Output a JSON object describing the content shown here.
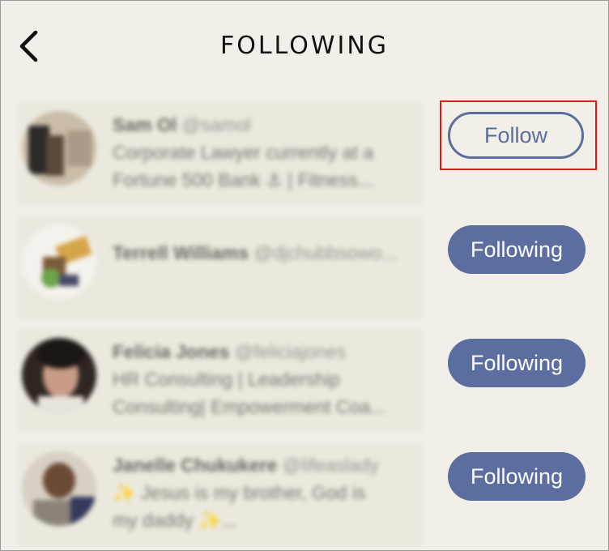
{
  "header": {
    "title": "FOLLOWING"
  },
  "users": [
    {
      "name": "Sam Ol",
      "handle": "@samol",
      "bio_lines": [
        "Corporate Lawyer currently at a",
        "Fortune 500 Bank ⚓ | Fitness..."
      ],
      "button_label": "Follow",
      "state": "follow",
      "avatar_colors": [
        "#5a4a3c",
        "#c9bda8",
        "#2e2a28"
      ]
    },
    {
      "name": "Terrell Williams",
      "handle": "@djchubbsowo...",
      "bio_lines": [],
      "button_label": "Following",
      "state": "following",
      "avatar_colors": [
        "#d6a54a",
        "#6ea44a",
        "#4a4a6a"
      ]
    },
    {
      "name": "Felicia Jones",
      "handle": "@feliciajones",
      "bio_lines": [
        "HR Consulting | Leadership",
        "Consulting| Empowerment Coa..."
      ],
      "button_label": "Following",
      "state": "following",
      "avatar_colors": [
        "#2f2622",
        "#c89c86",
        "#1c1714"
      ]
    },
    {
      "name": "Janelle Chukukere",
      "handle": "@lifeaslady",
      "bio_lines": [
        "✨ Jesus is my brother, God is",
        "my daddy ✨..."
      ],
      "button_label": "Following",
      "state": "following",
      "avatar_colors": [
        "#6b4a36",
        "#d8d0c4",
        "#343a5c"
      ]
    }
  ],
  "colors": {
    "accent": "#5c6ea0",
    "background": "#f1efe7",
    "highlight": "#e01818"
  }
}
